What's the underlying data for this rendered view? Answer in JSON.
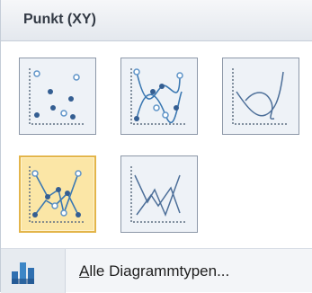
{
  "gallery": {
    "title": "Punkt (XY)",
    "thumbnails": [
      {
        "name": "scatter-markers-only-icon",
        "selected": false
      },
      {
        "name": "scatter-smooth-lines-markers-icon",
        "selected": false
      },
      {
        "name": "scatter-smooth-lines-icon",
        "selected": false
      },
      {
        "name": "scatter-straight-lines-markers-icon",
        "selected": true
      },
      {
        "name": "scatter-straight-lines-icon",
        "selected": false
      }
    ]
  },
  "footer": {
    "icon": "bar-chart-icon",
    "mnemonic": "A",
    "label_rest": "lle Diagrammtypen..."
  },
  "colors": {
    "line": "#3b78b2",
    "marker_fill": "#345e92",
    "marker_hollow_stroke": "#5f94c8",
    "axis": "#5f6f82",
    "selected_bg": "#fbe6a6",
    "selected_border": "#e3b54a"
  }
}
